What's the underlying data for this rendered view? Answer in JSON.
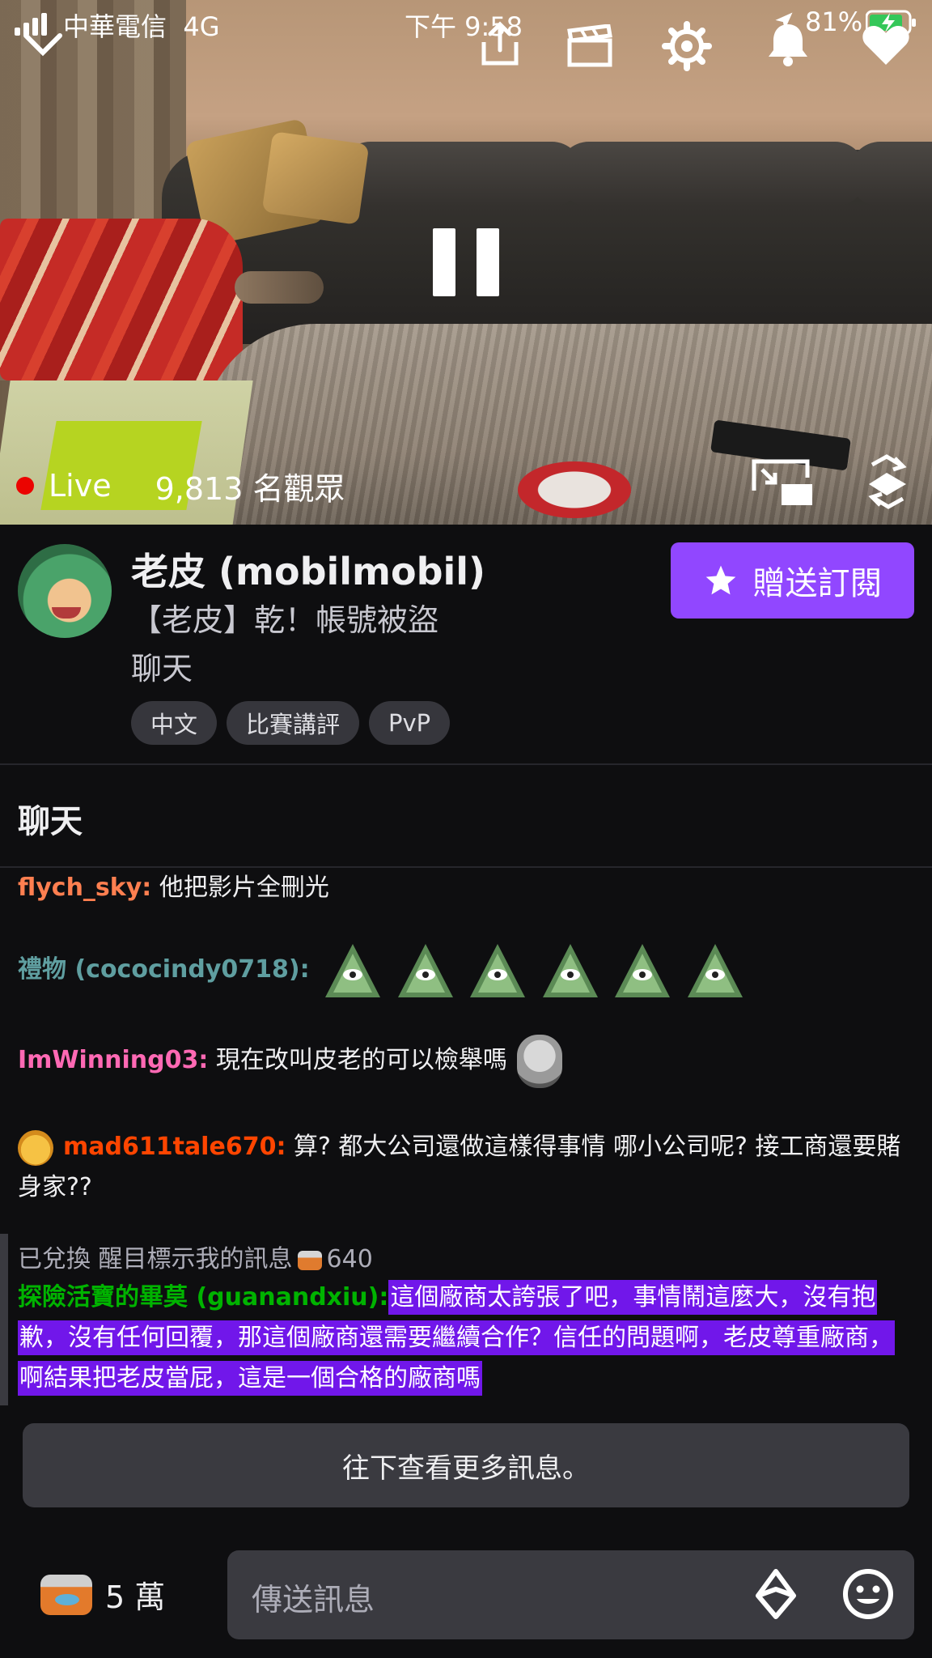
{
  "status_bar": {
    "carrier": "中華電信",
    "network": "4G",
    "time": "下午 9:58",
    "battery": "81%"
  },
  "player": {
    "live_label": "Live",
    "viewers": "9,813 名觀眾",
    "live_color": "#eb0400"
  },
  "channel": {
    "name": "老皮 (mobilmobil)",
    "title_line1": "【老皮】乾！帳號被盜",
    "title_line2": "聊天",
    "tags": [
      "中文",
      "比賽講評",
      "PvP"
    ],
    "gift_button": "贈送訂閱",
    "accent": "#9147ff"
  },
  "chat": {
    "header": "聊天",
    "messages": [
      {
        "user": "flych_sky:",
        "user_color": "#ff7f50",
        "text": " 他把影片全刪光"
      },
      {
        "user": "禮物 (cococindy0718):",
        "user_color": "#5f9ea0",
        "emote": "illuminati-emote",
        "emote_count": 6
      },
      {
        "user": "ImWinning03:",
        "user_color": "#ff69b4",
        "text": " 現在改叫皮老的可以檢舉嗎",
        "emote": "kappa-emote"
      },
      {
        "user": "mad611tale670:",
        "user_color": "#ff4500",
        "text": " 算? 都大公司還做這樣得事情 哪小公司呢? 接工商還要賭身家??",
        "badge": "nerd-badge"
      }
    ],
    "highlight": {
      "redeem_text": "已兌換 醒目標示我的訊息",
      "redeem_cost": "640",
      "user": "探險活寶的畢莫 (guanandxiu):",
      "user_color": "#00b300",
      "text": "這個廠商太誇張了吧，事情鬧這麼大，沒有抱歉，沒有任何回覆，那這個廠商還需要繼續合作？信任的問題啊，老皮尊重廠商，啊結果把老皮當屁，這是一個合格的廠商嗎",
      "highlight_color": "#7117ea"
    },
    "more_messages_button": "往下查看更多訊息。"
  },
  "input_bar": {
    "bits_amount": "5 萬",
    "placeholder": "傳送訊息"
  }
}
